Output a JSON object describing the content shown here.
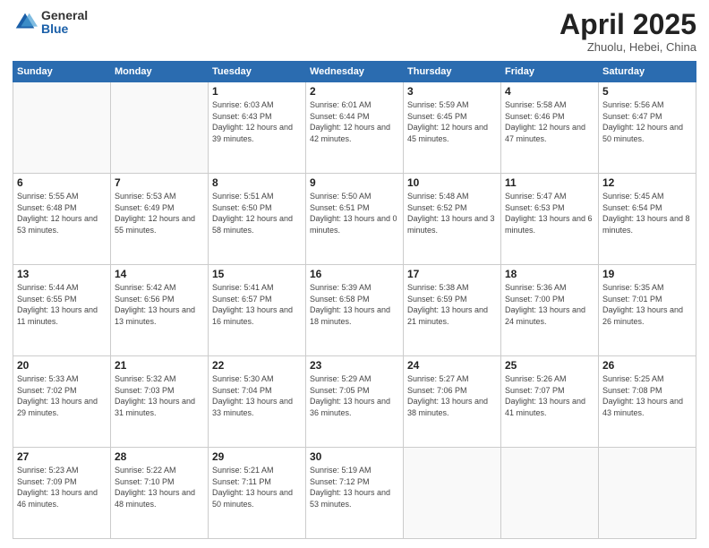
{
  "logo": {
    "general": "General",
    "blue": "Blue"
  },
  "header": {
    "month": "April 2025",
    "location": "Zhuolu, Hebei, China"
  },
  "weekdays": [
    "Sunday",
    "Monday",
    "Tuesday",
    "Wednesday",
    "Thursday",
    "Friday",
    "Saturday"
  ],
  "weeks": [
    [
      {
        "day": "",
        "sunrise": "",
        "sunset": "",
        "daylight": ""
      },
      {
        "day": "",
        "sunrise": "",
        "sunset": "",
        "daylight": ""
      },
      {
        "day": "1",
        "sunrise": "Sunrise: 6:03 AM",
        "sunset": "Sunset: 6:43 PM",
        "daylight": "Daylight: 12 hours and 39 minutes."
      },
      {
        "day": "2",
        "sunrise": "Sunrise: 6:01 AM",
        "sunset": "Sunset: 6:44 PM",
        "daylight": "Daylight: 12 hours and 42 minutes."
      },
      {
        "day": "3",
        "sunrise": "Sunrise: 5:59 AM",
        "sunset": "Sunset: 6:45 PM",
        "daylight": "Daylight: 12 hours and 45 minutes."
      },
      {
        "day": "4",
        "sunrise": "Sunrise: 5:58 AM",
        "sunset": "Sunset: 6:46 PM",
        "daylight": "Daylight: 12 hours and 47 minutes."
      },
      {
        "day": "5",
        "sunrise": "Sunrise: 5:56 AM",
        "sunset": "Sunset: 6:47 PM",
        "daylight": "Daylight: 12 hours and 50 minutes."
      }
    ],
    [
      {
        "day": "6",
        "sunrise": "Sunrise: 5:55 AM",
        "sunset": "Sunset: 6:48 PM",
        "daylight": "Daylight: 12 hours and 53 minutes."
      },
      {
        "day": "7",
        "sunrise": "Sunrise: 5:53 AM",
        "sunset": "Sunset: 6:49 PM",
        "daylight": "Daylight: 12 hours and 55 minutes."
      },
      {
        "day": "8",
        "sunrise": "Sunrise: 5:51 AM",
        "sunset": "Sunset: 6:50 PM",
        "daylight": "Daylight: 12 hours and 58 minutes."
      },
      {
        "day": "9",
        "sunrise": "Sunrise: 5:50 AM",
        "sunset": "Sunset: 6:51 PM",
        "daylight": "Daylight: 13 hours and 0 minutes."
      },
      {
        "day": "10",
        "sunrise": "Sunrise: 5:48 AM",
        "sunset": "Sunset: 6:52 PM",
        "daylight": "Daylight: 13 hours and 3 minutes."
      },
      {
        "day": "11",
        "sunrise": "Sunrise: 5:47 AM",
        "sunset": "Sunset: 6:53 PM",
        "daylight": "Daylight: 13 hours and 6 minutes."
      },
      {
        "day": "12",
        "sunrise": "Sunrise: 5:45 AM",
        "sunset": "Sunset: 6:54 PM",
        "daylight": "Daylight: 13 hours and 8 minutes."
      }
    ],
    [
      {
        "day": "13",
        "sunrise": "Sunrise: 5:44 AM",
        "sunset": "Sunset: 6:55 PM",
        "daylight": "Daylight: 13 hours and 11 minutes."
      },
      {
        "day": "14",
        "sunrise": "Sunrise: 5:42 AM",
        "sunset": "Sunset: 6:56 PM",
        "daylight": "Daylight: 13 hours and 13 minutes."
      },
      {
        "day": "15",
        "sunrise": "Sunrise: 5:41 AM",
        "sunset": "Sunset: 6:57 PM",
        "daylight": "Daylight: 13 hours and 16 minutes."
      },
      {
        "day": "16",
        "sunrise": "Sunrise: 5:39 AM",
        "sunset": "Sunset: 6:58 PM",
        "daylight": "Daylight: 13 hours and 18 minutes."
      },
      {
        "day": "17",
        "sunrise": "Sunrise: 5:38 AM",
        "sunset": "Sunset: 6:59 PM",
        "daylight": "Daylight: 13 hours and 21 minutes."
      },
      {
        "day": "18",
        "sunrise": "Sunrise: 5:36 AM",
        "sunset": "Sunset: 7:00 PM",
        "daylight": "Daylight: 13 hours and 24 minutes."
      },
      {
        "day": "19",
        "sunrise": "Sunrise: 5:35 AM",
        "sunset": "Sunset: 7:01 PM",
        "daylight": "Daylight: 13 hours and 26 minutes."
      }
    ],
    [
      {
        "day": "20",
        "sunrise": "Sunrise: 5:33 AM",
        "sunset": "Sunset: 7:02 PM",
        "daylight": "Daylight: 13 hours and 29 minutes."
      },
      {
        "day": "21",
        "sunrise": "Sunrise: 5:32 AM",
        "sunset": "Sunset: 7:03 PM",
        "daylight": "Daylight: 13 hours and 31 minutes."
      },
      {
        "day": "22",
        "sunrise": "Sunrise: 5:30 AM",
        "sunset": "Sunset: 7:04 PM",
        "daylight": "Daylight: 13 hours and 33 minutes."
      },
      {
        "day": "23",
        "sunrise": "Sunrise: 5:29 AM",
        "sunset": "Sunset: 7:05 PM",
        "daylight": "Daylight: 13 hours and 36 minutes."
      },
      {
        "day": "24",
        "sunrise": "Sunrise: 5:27 AM",
        "sunset": "Sunset: 7:06 PM",
        "daylight": "Daylight: 13 hours and 38 minutes."
      },
      {
        "day": "25",
        "sunrise": "Sunrise: 5:26 AM",
        "sunset": "Sunset: 7:07 PM",
        "daylight": "Daylight: 13 hours and 41 minutes."
      },
      {
        "day": "26",
        "sunrise": "Sunrise: 5:25 AM",
        "sunset": "Sunset: 7:08 PM",
        "daylight": "Daylight: 13 hours and 43 minutes."
      }
    ],
    [
      {
        "day": "27",
        "sunrise": "Sunrise: 5:23 AM",
        "sunset": "Sunset: 7:09 PM",
        "daylight": "Daylight: 13 hours and 46 minutes."
      },
      {
        "day": "28",
        "sunrise": "Sunrise: 5:22 AM",
        "sunset": "Sunset: 7:10 PM",
        "daylight": "Daylight: 13 hours and 48 minutes."
      },
      {
        "day": "29",
        "sunrise": "Sunrise: 5:21 AM",
        "sunset": "Sunset: 7:11 PM",
        "daylight": "Daylight: 13 hours and 50 minutes."
      },
      {
        "day": "30",
        "sunrise": "Sunrise: 5:19 AM",
        "sunset": "Sunset: 7:12 PM",
        "daylight": "Daylight: 13 hours and 53 minutes."
      },
      {
        "day": "",
        "sunrise": "",
        "sunset": "",
        "daylight": ""
      },
      {
        "day": "",
        "sunrise": "",
        "sunset": "",
        "daylight": ""
      },
      {
        "day": "",
        "sunrise": "",
        "sunset": "",
        "daylight": ""
      }
    ]
  ]
}
